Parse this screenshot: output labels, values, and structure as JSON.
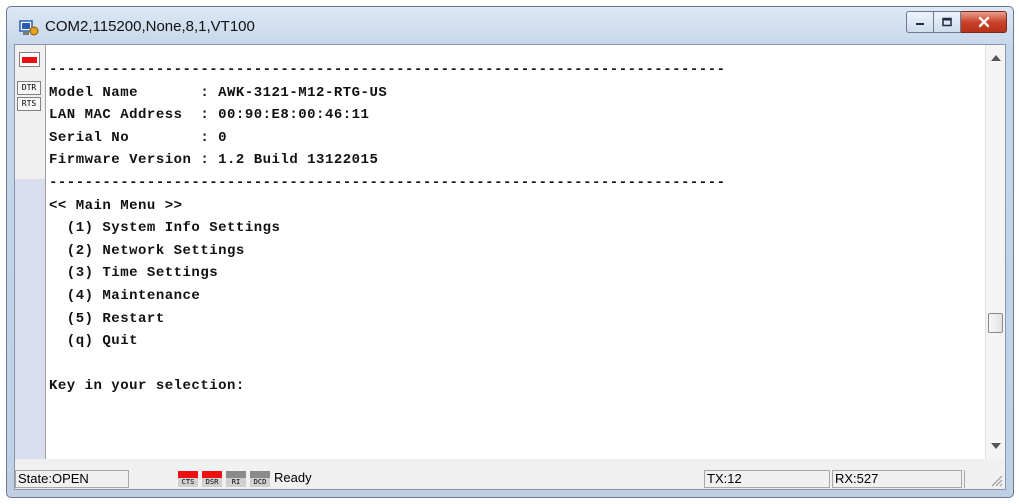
{
  "window": {
    "title": "COM2,115200,None,8,1,VT100",
    "controls": [
      "minimize",
      "maximize",
      "close"
    ]
  },
  "left_panel": {
    "break_indicator": "red",
    "signals": [
      {
        "label": "DTR"
      },
      {
        "label": "RTS"
      }
    ]
  },
  "terminal": {
    "lines": [
      "----------------------------------------------------------------------------",
      "Model Name       : AWK-3121-M12-RTG-US",
      "LAN MAC Address  : 00:90:E8:00:46:11",
      "Serial No        : 0",
      "Firmware Version : 1.2 Build 13122015",
      "----------------------------------------------------------------------------",
      "<< Main Menu >>",
      "  (1) System Info Settings",
      "  (2) Network Settings",
      "  (3) Time Settings",
      "  (4) Maintenance",
      "  (5) Restart",
      "  (q) Quit",
      "",
      "Key in your selection:"
    ]
  },
  "status_bar": {
    "state": "State:OPEN",
    "leds": [
      {
        "label": "CTS",
        "color": "#ee1010",
        "active": true
      },
      {
        "label": "DSR",
        "color": "#ee1010",
        "active": true
      },
      {
        "label": "RI",
        "color": "#8a8a8a",
        "active": false
      },
      {
        "label": "DCD",
        "color": "#8a8a8a",
        "active": false
      }
    ],
    "message": "Ready",
    "tx": "TX:12",
    "rx": "RX:527"
  },
  "colors": {
    "led_active": "#ee1010",
    "led_inactive": "#8a8a8a",
    "close_button": "#c9432a"
  }
}
